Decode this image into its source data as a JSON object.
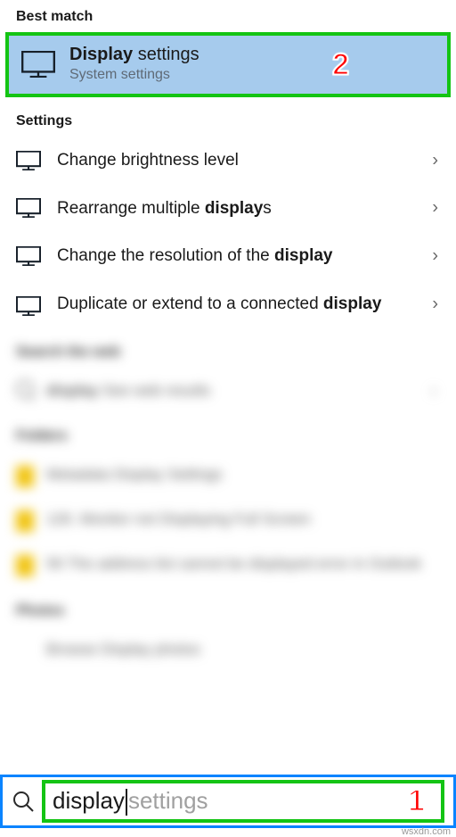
{
  "headers": {
    "best_match": "Best match",
    "settings": "Settings",
    "search_web": "Search the web",
    "folders": "Folders",
    "photos": "Photos"
  },
  "best_match": {
    "title_bold": "Display",
    "title_rest": " settings",
    "subtitle": "System settings",
    "marker": "2"
  },
  "settings_items": [
    {
      "pre": "Change brightness level",
      "bold": "",
      "post": ""
    },
    {
      "pre": "Rearrange multiple ",
      "bold": "display",
      "post": "s"
    },
    {
      "pre": "Change the resolution of the ",
      "bold": "display",
      "post": ""
    },
    {
      "pre": "Duplicate or extend to a connected ",
      "bold": "display",
      "post": ""
    }
  ],
  "blur_web": {
    "prefix": "display",
    "suffix": "  See web results"
  },
  "blur_folders": [
    "Metadata Display Settings",
    "126. Monitor not Displaying Full Screen",
    "56 The address list cannot be displayed error in Outlook"
  ],
  "blur_photos": "Browse Display photos",
  "search": {
    "typed": "display",
    "ghost": "settings",
    "marker": "1"
  },
  "watermark": "wsxdn.com"
}
